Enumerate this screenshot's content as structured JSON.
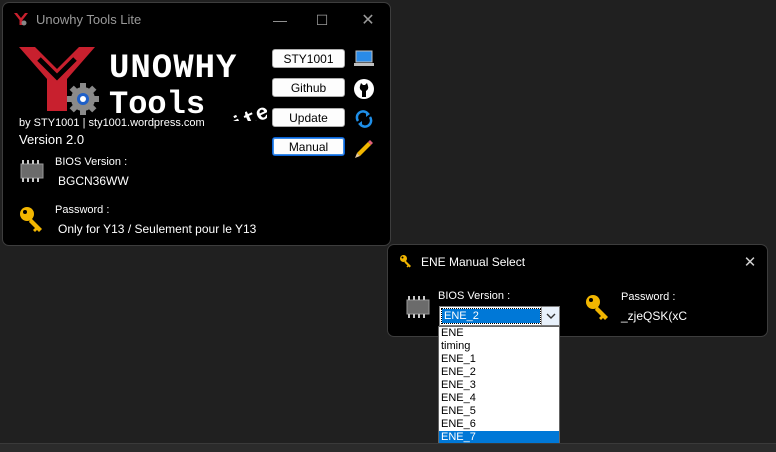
{
  "main_window": {
    "title": "Unowhy Tools Lite",
    "logo_line1": "UNOWHY",
    "logo_line2": "Tools",
    "logo_lite": "Lite",
    "byline": "by STY1001 | sty1001.wordpress.com",
    "version": "Version 2.0",
    "bios_label": "BIOS Version :",
    "bios_value": "BGCN36WW",
    "password_label": "Password :",
    "password_value": "Only for Y13 / Seulement pour le Y13",
    "buttons": [
      {
        "label": "STY1001",
        "icon": "laptop-icon"
      },
      {
        "label": "Github",
        "icon": "github-icon"
      },
      {
        "label": "Update",
        "icon": "refresh-icon"
      },
      {
        "label": "Manual",
        "icon": "pencil-icon"
      }
    ]
  },
  "ene_dialog": {
    "title": "ENE Manual Select",
    "bios_label": "BIOS Version :",
    "selected_value": "ENE_2",
    "password_label": "Password :",
    "password_value": "_zjeQSK(xC",
    "options": [
      "ENE",
      "timing",
      "ENE_1",
      "ENE_2",
      "ENE_3",
      "ENE_4",
      "ENE_5",
      "ENE_6",
      "ENE_7"
    ],
    "highlighted_option": "ENE_7"
  },
  "colors": {
    "accent_red": "#c8202e",
    "highlight_blue": "#0078d7",
    "key_yellow": "#f2b600"
  }
}
